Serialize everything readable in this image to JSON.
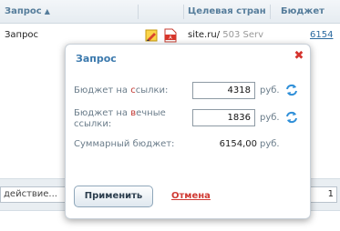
{
  "table": {
    "headers": {
      "query": "Запрос",
      "target": "Целевая стран",
      "budget": "Бюджет"
    },
    "row": {
      "query": "Запрос",
      "site": "site.ru/",
      "status": "503 Serv",
      "budget": "6154"
    }
  },
  "bottom_bar": {
    "action_select": "действие...",
    "page": "1"
  },
  "modal": {
    "title": "Запрос",
    "label_link_prefix": "Бюджет на ",
    "label_link_hl": "с",
    "label_link_suffix": "сылки:",
    "label_eternal_prefix": "Бюджет на ",
    "label_eternal_hl": "в",
    "label_eternal_suffix": "ечные ссылки:",
    "link_budget": "4318",
    "eternal_budget": "1836",
    "currency": "руб.",
    "total_label": "Суммарный бюджет:",
    "total_value": "6154,00",
    "total_currency": "руб.",
    "apply_label": "Применить",
    "cancel_label": "Отмена"
  },
  "colors": {
    "accent": "#3b79ad",
    "danger": "#d03a33"
  }
}
